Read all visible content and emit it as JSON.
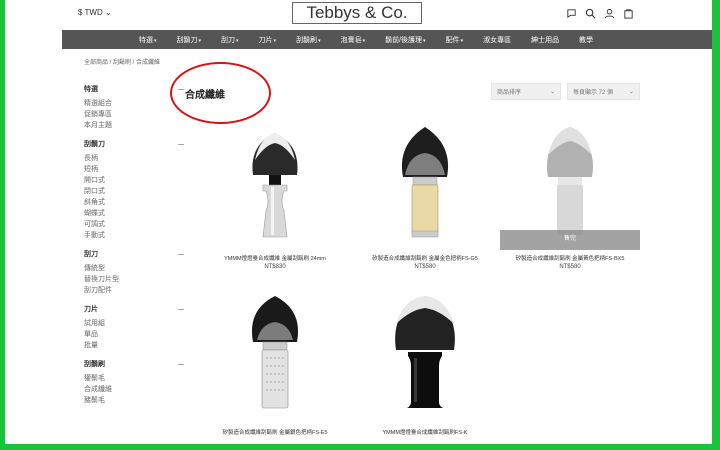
{
  "header": {
    "currency": "$ TWD",
    "logo": "Tebbys & Co."
  },
  "nav": [
    "特選",
    "刮鬍刀",
    "刮刀",
    "刀片",
    "刮鬍刷",
    "泡膏皂",
    "鬍前/後護理",
    "配件",
    "淑女專區",
    "紳士用品",
    "教學"
  ],
  "breadcrumb": "全部商品 / 刮鬍刷 / 合成纖維",
  "category_title": "合成纖維",
  "sort_select": "商品排序",
  "per_page_select": "每頁顯示 72 個",
  "sidebar": [
    {
      "title": "特選",
      "items": [
        "精選組合",
        "促銷專區",
        "本月主題"
      ]
    },
    {
      "title": "刮鬍刀",
      "items": [
        "長柄",
        "短柄",
        "開口式",
        "閉口式",
        "斜角式",
        "蝴蝶式",
        "可調式",
        "手動式"
      ]
    },
    {
      "title": "刮刀",
      "items": [
        "傳統型",
        "替換刀片型",
        "刮刀配件"
      ]
    },
    {
      "title": "刀片",
      "items": [
        "試用組",
        "單品",
        "批量"
      ]
    },
    {
      "title": "刮鬍刷",
      "items": [
        "獾鬃毛",
        "合成纖維",
        "豬鬃毛"
      ]
    }
  ],
  "products": [
    {
      "name": "YMMM燈燈臺合成纖維 金屬刮鬍刷 24mm",
      "price": "NT$830",
      "sold_out": false
    },
    {
      "name": "矽製造合成纖維刮鬍刷 金屬金色把柄FS-G5",
      "price": "NT$580",
      "sold_out": false
    },
    {
      "name": "矽製造合成纖維刮鬍刷 金屬黃色把柄FS-BX5",
      "price": "NT$580",
      "sold_out": true,
      "sold_label": "售完"
    },
    {
      "name": "矽製造合成纖維刮鬍刷 金屬銀色把柄FS-E5",
      "price": "",
      "sold_out": false
    },
    {
      "name": "YMMM燈燈臺合成纖維刮鬍刷FS-K",
      "price": "",
      "sold_out": false
    }
  ],
  "colors": {
    "nav_bg": "#555555",
    "frame": "#19c43a",
    "circle": "#d41414"
  }
}
